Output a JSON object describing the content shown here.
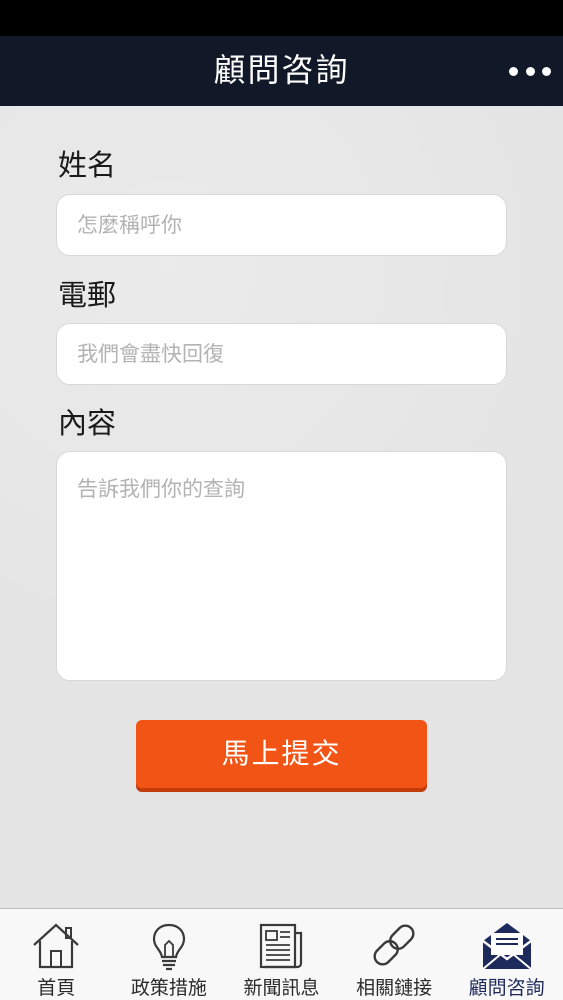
{
  "header": {
    "title": "顧問咨詢"
  },
  "form": {
    "name_label": "姓名",
    "name_placeholder": "怎麼稱呼你",
    "email_label": "電郵",
    "email_placeholder": "我們會盡快回復",
    "content_label": "內容",
    "content_placeholder": "告訴我們你的查詢",
    "submit_label": "馬上提交"
  },
  "tabs": [
    {
      "label": "首頁",
      "icon": "home-icon"
    },
    {
      "label": "政策措施",
      "icon": "lightbulb-icon"
    },
    {
      "label": "新聞訊息",
      "icon": "newspaper-icon"
    },
    {
      "label": "相關鏈接",
      "icon": "link-icon"
    },
    {
      "label": "顧問咨詢",
      "icon": "envelope-icon",
      "active": true
    }
  ],
  "colors": {
    "nav_background": "#111828",
    "submit_button": "#f25416",
    "active_tab": "#1e2a5c"
  }
}
